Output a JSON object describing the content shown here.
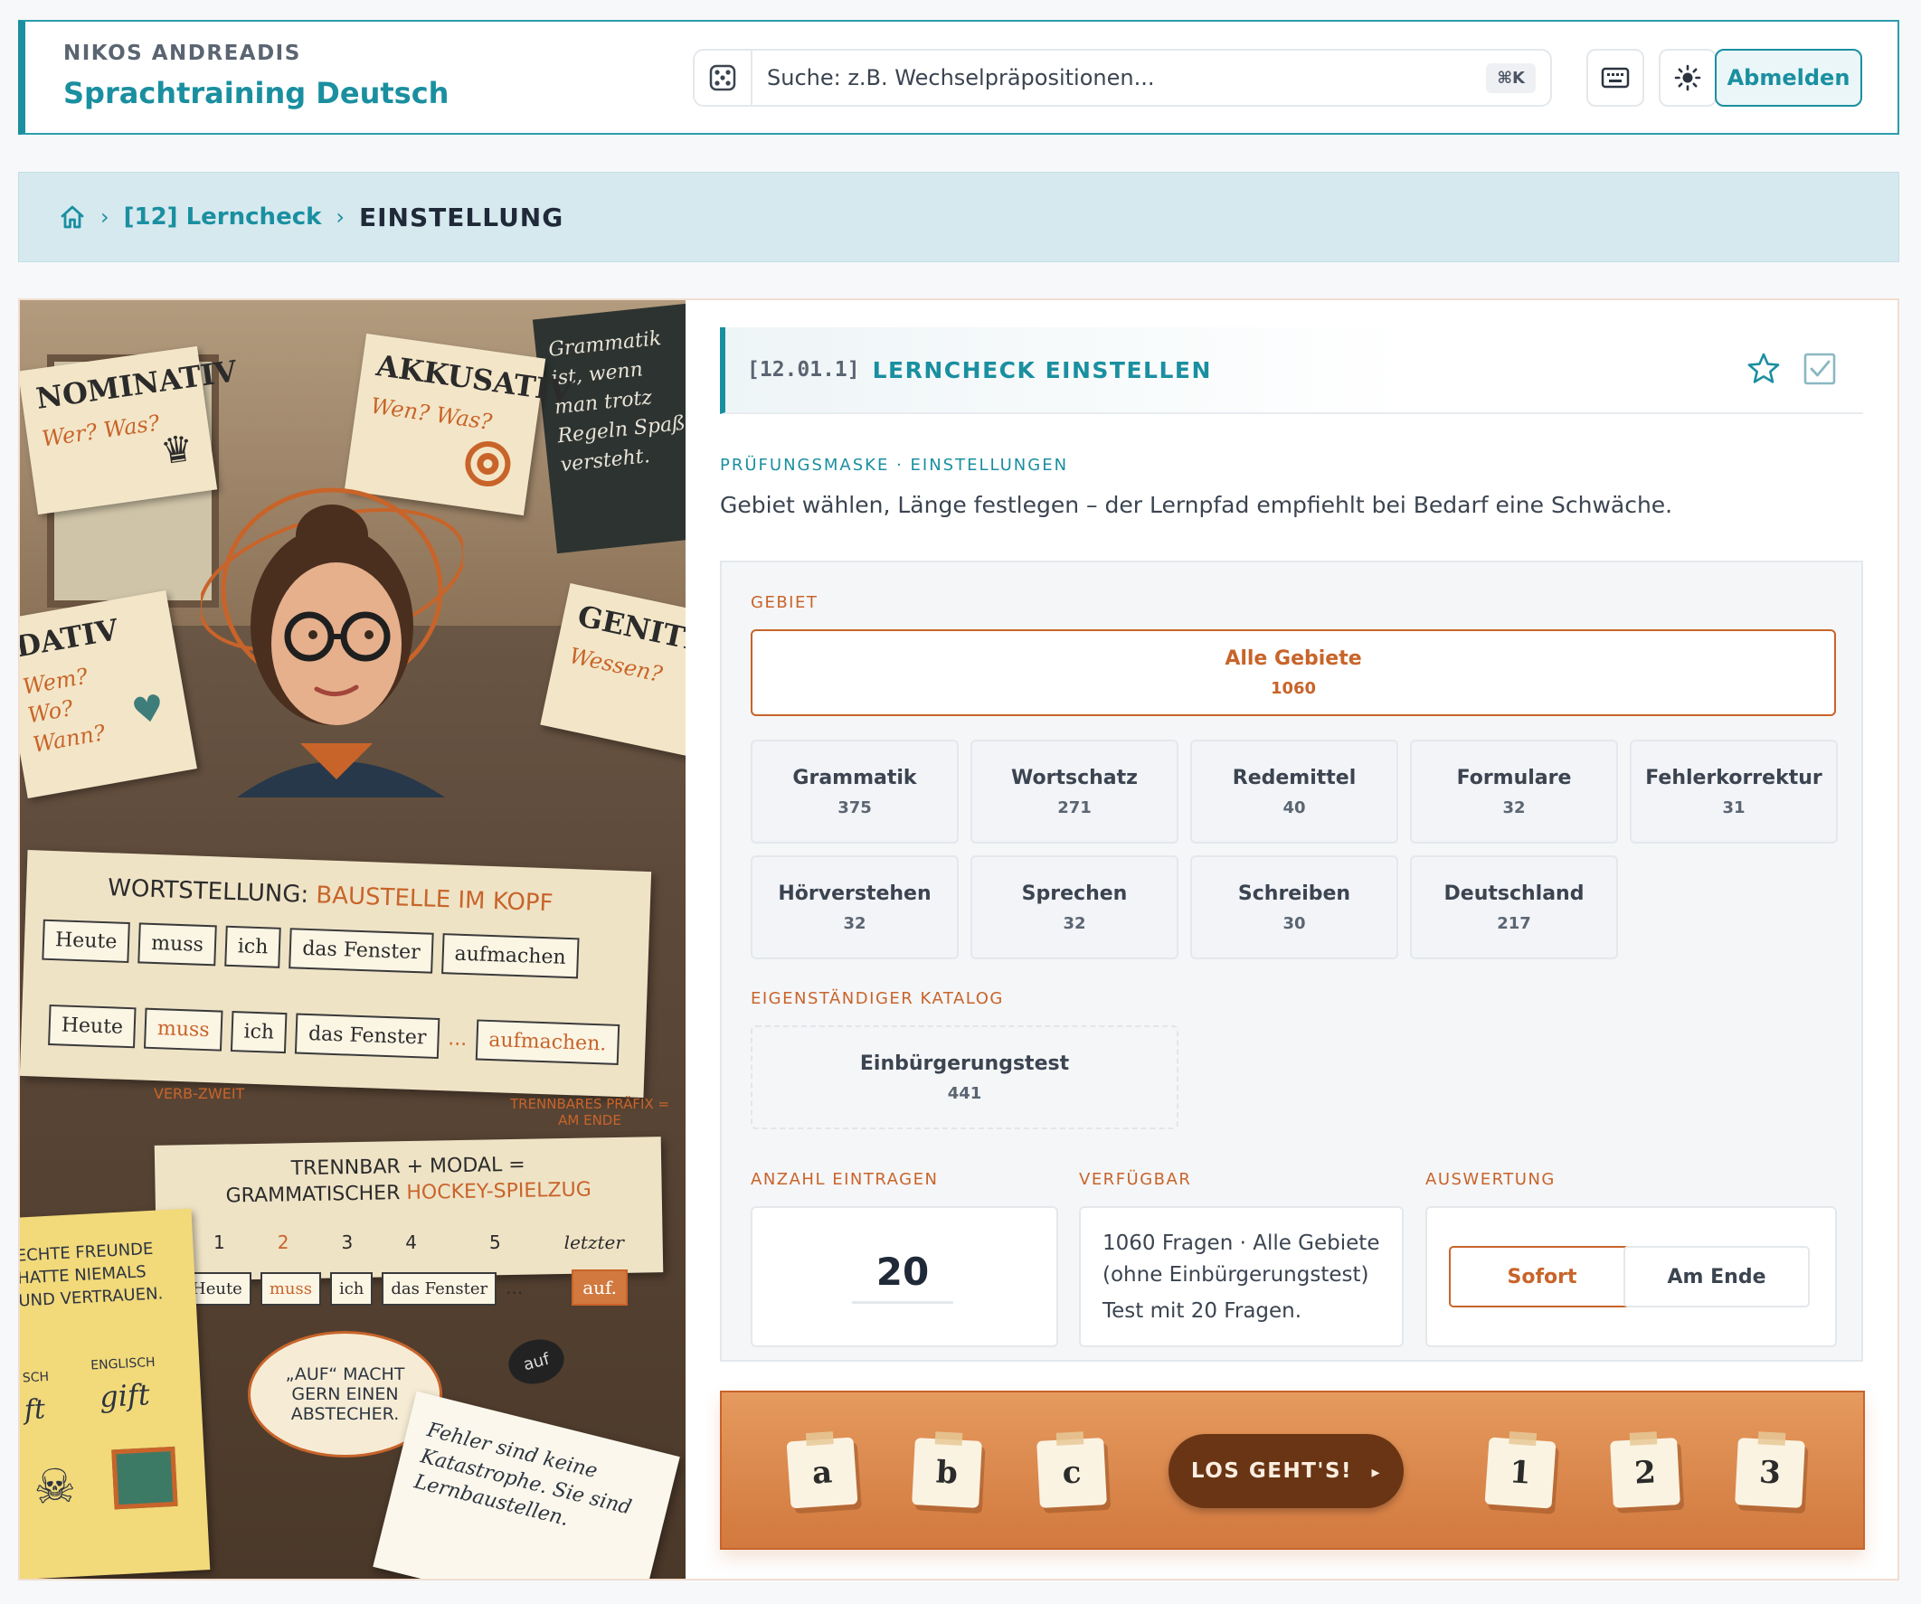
{
  "header": {
    "user_name": "NIKOS ANDREADIS",
    "app_title": "Sprachtraining Deutsch",
    "search_placeholder": "Suche: z.B. Wechselpräpositionen...",
    "search_shortcut": "⌘K",
    "logout_label": "Abmelden"
  },
  "breadcrumb": {
    "home_icon": "home-icon",
    "items": [
      "[12] Lerncheck",
      "EINSTELLUNG"
    ]
  },
  "illustration": {
    "notes": {
      "nominativ": {
        "title": "NOMINATIV",
        "q": "Wer? Was?"
      },
      "akkusativ": {
        "title": "AKKUSATIV",
        "q": "Wen? Was?"
      },
      "dativ": {
        "title": "DATIV",
        "q": "Wem? Wo? Wann?"
      },
      "genitiv": {
        "title": "GENITIV",
        "q": "Wessen?"
      }
    },
    "chalkboard": "Grammatik ist, wenn man trotz Regeln Spaß versteht.",
    "wortstellung_title": "WORTSTELLUNG:",
    "wortstellung_sub": "BAUSTELLE IM KOPF",
    "row1": [
      "Heute",
      "muss",
      "ich",
      "das Fenster",
      "aufmachen"
    ],
    "row2": [
      "Heute",
      "muss",
      "ich",
      "das Fenster",
      "...",
      "aufmachen."
    ],
    "verb_zweit": "VERB-ZWEIT",
    "trennbares": "TRENNBARES PRÄFIX = AM ENDE",
    "trennbar_title": "TRENNBAR + MODAL =",
    "trennbar_sub_a": "GRAMMATISCHER",
    "trennbar_sub_b": "HOCKEY-SPIELZUG",
    "nums": [
      "1",
      "2",
      "3",
      "4",
      "5",
      "letzter"
    ],
    "row3": [
      "Heute",
      "muss",
      "ich",
      "das Fenster",
      "...",
      "auf."
    ],
    "puck": "auf",
    "bubble": "„AUF“ MACHT GERN EINEN ABSTECHER.",
    "yellow_note": "ECHTE FREUNDE HATTE NIEMALS UND VERTRAUEN.",
    "englisch": "ENGLISCH",
    "gift": "gift",
    "deutsch_partial": "SCH",
    "ft": "ft",
    "notebook": "Fehler sind keine Katastrophe. Sie sind Lernbaustellen."
  },
  "section": {
    "number": "[12.01.1]",
    "title": "LERNCHECK EINSTELLEN",
    "kicker": "PRÜFUNGSMASKE · EINSTELLUNGEN",
    "lead": "Gebiet wählen, Länge festlegen – der Lernpfad empfiehlt bei Bedarf eine Schwäche."
  },
  "form": {
    "gebiet_label": "GEBIET",
    "all": {
      "name": "Alle Gebiete",
      "count": "1060"
    },
    "areas": [
      {
        "name": "Grammatik",
        "count": "375"
      },
      {
        "name": "Wortschatz",
        "count": "271"
      },
      {
        "name": "Redemittel",
        "count": "40"
      },
      {
        "name": "Formulare",
        "count": "32"
      },
      {
        "name": "Fehlerkorrektur",
        "count": "31"
      },
      {
        "name": "Hörverstehen",
        "count": "32"
      },
      {
        "name": "Sprechen",
        "count": "32"
      },
      {
        "name": "Schreiben",
        "count": "30"
      },
      {
        "name": "Deutschland",
        "count": "217"
      }
    ],
    "katalog_label": "EIGENSTÄNDIGER KATALOG",
    "katalog": {
      "name": "Einbürgerungstest",
      "count": "441"
    },
    "anzahl_label": "ANZAHL EINTRAGEN",
    "anzahl_value": "20",
    "verfuegbar_label": "VERFÜGBAR",
    "verfuegbar_line1": "1060 Fragen · Alle Gebiete",
    "verfuegbar_line2": "(ohne Einbürgerungstest)",
    "verfuegbar_line3": "Test mit 20 Fragen.",
    "auswertung_label": "AUSWERTUNG",
    "auswertung_options": [
      "Sofort",
      "Am Ende"
    ],
    "auswertung_selected": "Sofort"
  },
  "launch": {
    "letters": [
      "a",
      "b",
      "c"
    ],
    "numbers": [
      "1",
      "2",
      "3"
    ],
    "go_label": "LOS GEHT'S!"
  },
  "colors": {
    "accent": "#1a8fa0",
    "orange": "#c8642a",
    "crumb_bg": "#d6e9ef"
  }
}
